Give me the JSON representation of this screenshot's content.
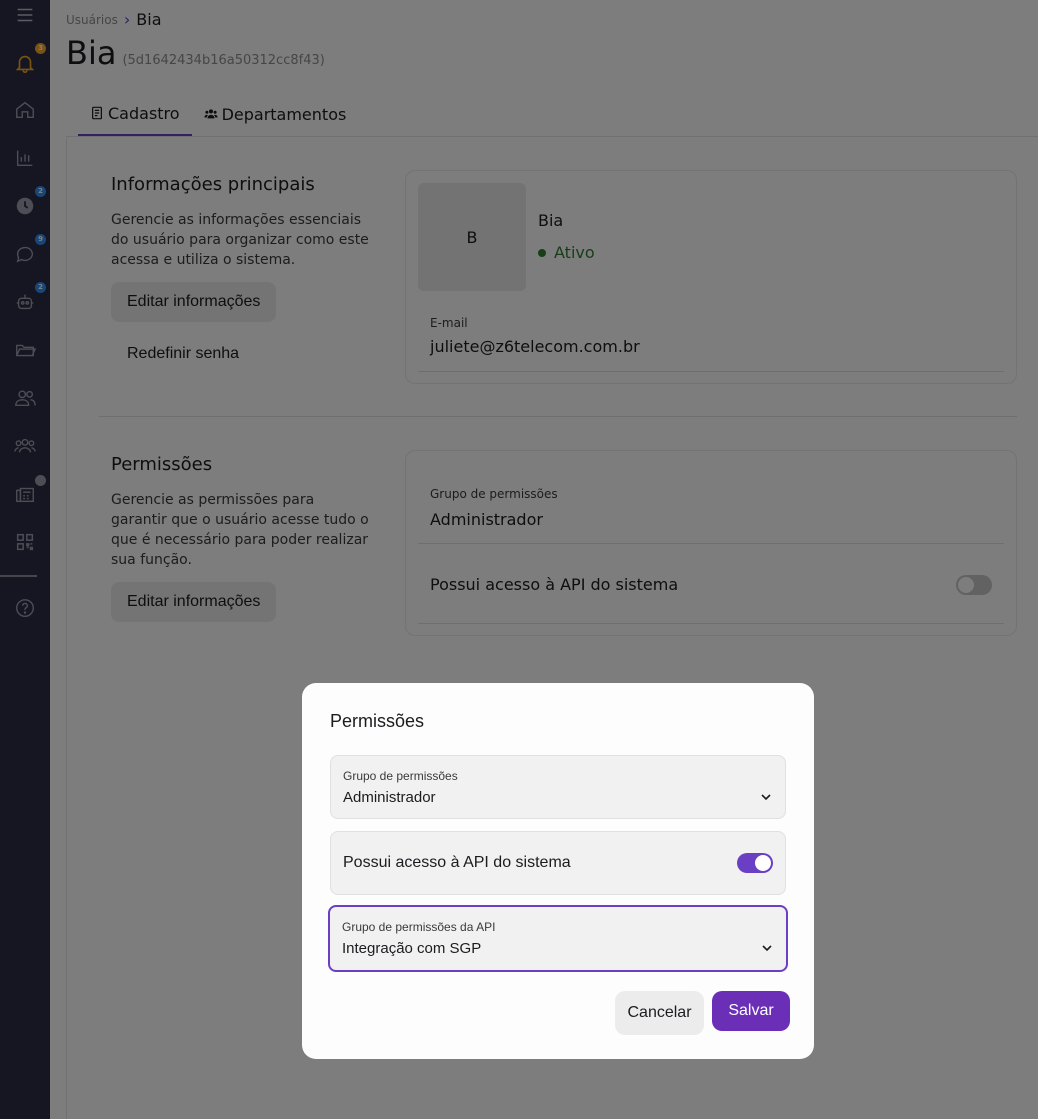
{
  "sidebar": {
    "items": [
      {
        "icon": "menu-icon"
      },
      {
        "icon": "bell-icon",
        "badge": "3",
        "badge_color": "#f5a623"
      },
      {
        "icon": "home-icon"
      },
      {
        "icon": "chart-icon"
      },
      {
        "icon": "clock-icon",
        "badge": "2",
        "badge_color": "#2f8cf0"
      },
      {
        "icon": "chat-icon",
        "badge": "9",
        "badge_color": "#2f8cf0"
      },
      {
        "icon": "robot-icon",
        "badge": "2",
        "badge_color": "#2f8cf0"
      },
      {
        "icon": "folder-icon"
      },
      {
        "icon": "users-icon"
      },
      {
        "icon": "groups-icon"
      },
      {
        "icon": "fax-icon"
      },
      {
        "icon": "qrcode-icon"
      },
      {
        "icon": "help-icon"
      }
    ]
  },
  "breadcrumb": {
    "parent": "Usuários",
    "current": "Bia"
  },
  "page": {
    "title": "Bia",
    "id": "(5d1642434b16a50312cc8f43)"
  },
  "tabs": [
    {
      "label": "Cadastro",
      "icon": "document-icon",
      "active": true
    },
    {
      "label": "Departamentos",
      "icon": "team-icon",
      "active": false
    }
  ],
  "info": {
    "title": "Informações principais",
    "description": "Gerencie as informações essenciais do usuário para organizar como este acessa e utiliza o sistema.",
    "edit_label": "Editar informações",
    "reset_label": "Redefinir senha",
    "avatar_letter": "B",
    "user_name": "Bia",
    "status": "Ativo",
    "email_label": "E-mail",
    "email_value": "juliete@z6telecom.com.br"
  },
  "permissions": {
    "title": "Permissões",
    "description": "Gerencie as permissões para garantir que o usuário acesse tudo o que é necessário para poder realizar sua função.",
    "edit_label": "Editar informações",
    "group_label": "Grupo de permissões",
    "group_value": "Administrador",
    "api_label": "Possui acesso à API do sistema",
    "api_enabled": false
  },
  "dialog": {
    "title": "Permissões",
    "group_label": "Grupo de permissões",
    "group_value": "Administrador",
    "api_label": "Possui acesso à API do sistema",
    "api_enabled": true,
    "api_group_label": "Grupo de permissões da API",
    "api_group_value": "Integração com SGP",
    "cancel_label": "Cancelar",
    "save_label": "Salvar"
  },
  "colors": {
    "accent": "#6b3fc4",
    "status_active": "#2e7d32",
    "sidebar_bg": "#2b2d42"
  }
}
